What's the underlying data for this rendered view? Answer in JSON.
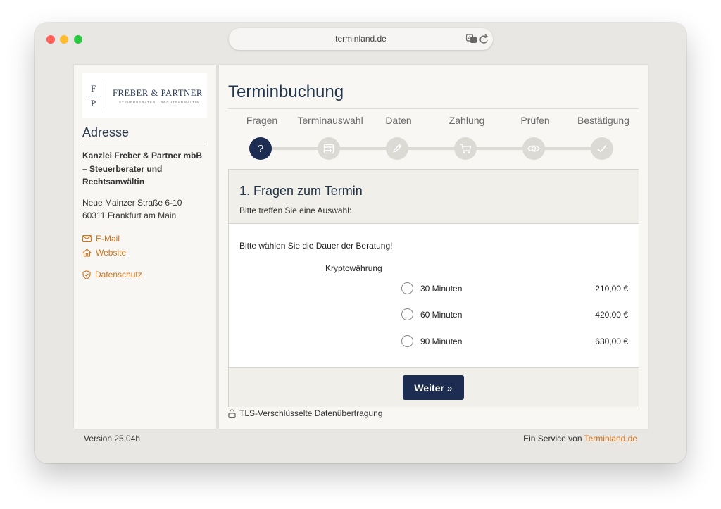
{
  "browser": {
    "url": "terminland.de"
  },
  "sidebar": {
    "logo": {
      "initial_top": "F",
      "initial_bottom": "P",
      "name": "FREBER & PARTNER",
      "tagline": "STEUERBERATER · RECHTSANWÄLTIN"
    },
    "address_title": "Adresse",
    "company": "Kanzlei Freber & Partner mbB – Steuerberater und Rechtsanwältin",
    "street": "Neue Mainzer Straße 6-10",
    "city": "60311 Frankfurt am Main",
    "links": {
      "email": "E-Mail",
      "website": "Website",
      "privacy": "Datenschutz"
    }
  },
  "main": {
    "title": "Terminbuchung",
    "steps": [
      {
        "label": "Fragen",
        "icon": "question-icon",
        "active": true,
        "symbol": "?"
      },
      {
        "label": "Terminauswahl",
        "icon": "calendar-icon",
        "active": false
      },
      {
        "label": "Daten",
        "icon": "pencil-icon",
        "active": false
      },
      {
        "label": "Zahlung",
        "icon": "cart-icon",
        "active": false
      },
      {
        "label": "Prüfen",
        "icon": "eye-icon",
        "active": false
      },
      {
        "label": "Bestätigung",
        "icon": "check-icon",
        "active": false
      }
    ],
    "card": {
      "title": "1. Fragen zum Termin",
      "subtitle": "Bitte treffen Sie eine Auswahl:",
      "question": "Bitte wählen Sie die Dauer der Beratung!",
      "group_label": "Kryptowährung",
      "options": [
        {
          "label": "30 Minuten",
          "price": "210,00 €",
          "selected": false
        },
        {
          "label": "60 Minuten",
          "price": "420,00 €",
          "selected": false
        },
        {
          "label": "90 Minuten",
          "price": "630,00 €",
          "selected": false
        }
      ],
      "next_button": "Weiter",
      "next_button_icon": "»"
    },
    "tls_note": "TLS-Verschlüsselte Datenübertragung"
  },
  "footer": {
    "version": "Version 25.04h",
    "service_prefix": "Ein Service von",
    "service_link": "Terminland.de"
  },
  "colors": {
    "accent_orange": "#d1731c",
    "primary_navy": "#1d2d52",
    "panel_bg": "#f8f7f4",
    "card_header_bg": "#f1efe9"
  }
}
